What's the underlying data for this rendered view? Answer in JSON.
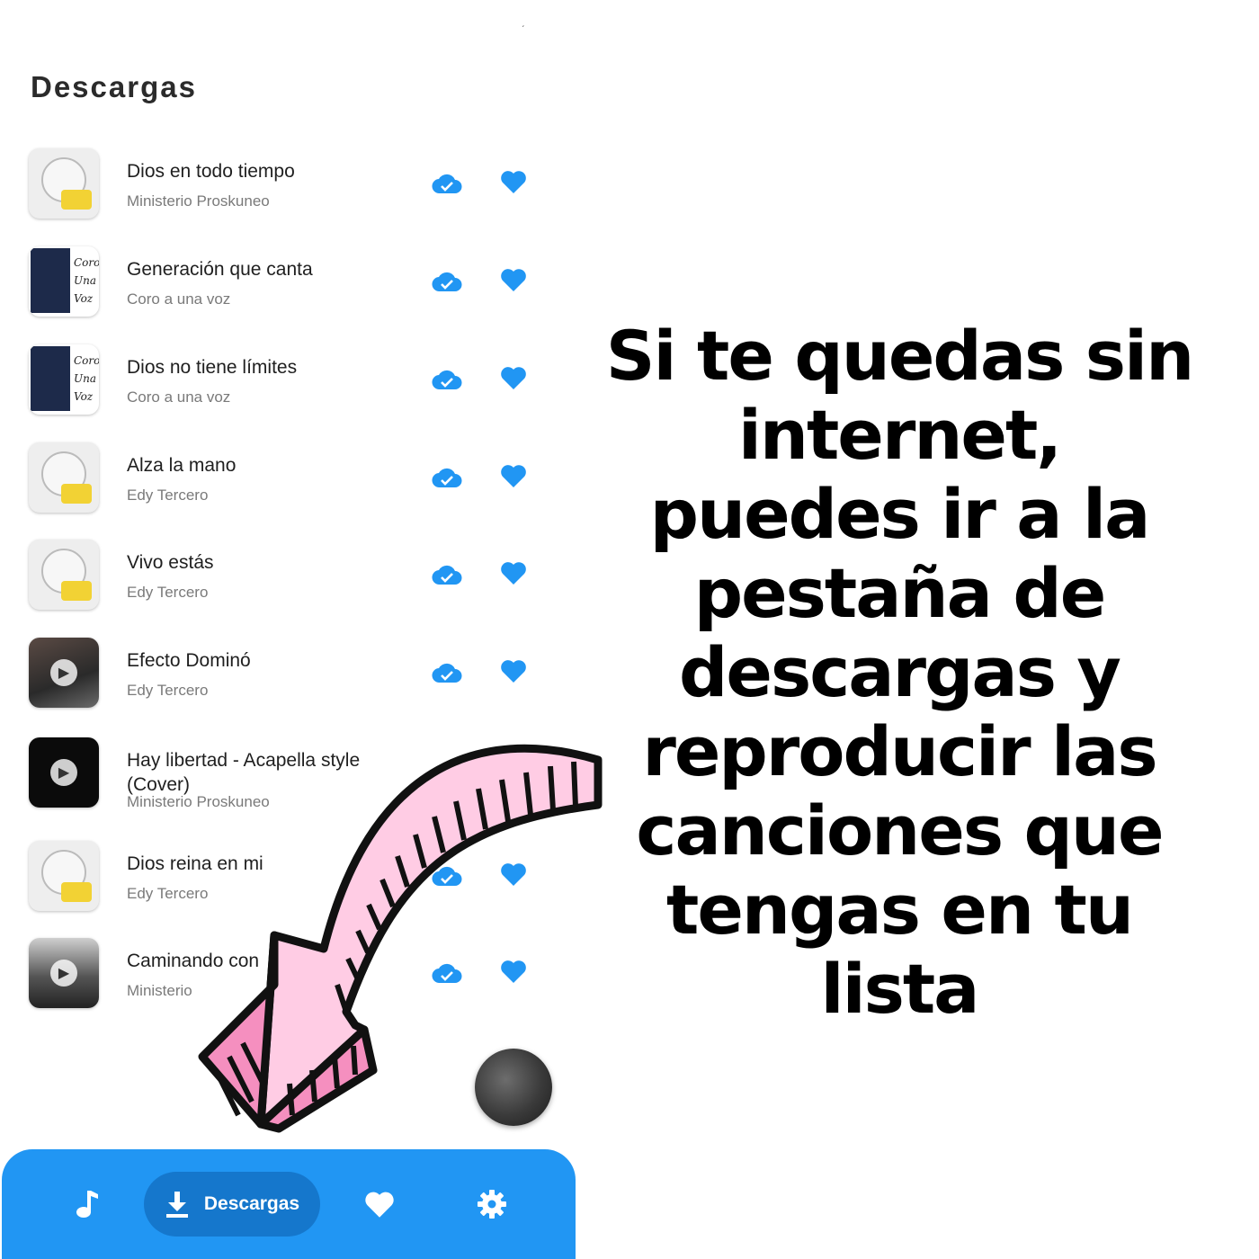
{
  "header": {
    "title": "Descargas",
    "tick": "ˊ"
  },
  "songs": [
    {
      "title": "Dios en todo tiempo",
      "artist": "Ministerio Proskuneo",
      "cover": "logo"
    },
    {
      "title": "Generación que canta",
      "artist": "Coro a una voz",
      "cover": "coro"
    },
    {
      "title": "Dios no tiene límites",
      "artist": "Coro a una voz",
      "cover": "coro"
    },
    {
      "title": "Alza la mano",
      "artist": "Edy Tercero",
      "cover": "logo"
    },
    {
      "title": "Vivo estás",
      "artist": "Edy Tercero",
      "cover": "logo"
    },
    {
      "title": "Efecto Dominó",
      "artist": "Edy Tercero",
      "cover": "photo"
    },
    {
      "title": "Hay libertad - Acapella style (Cover)",
      "artist": "Ministerio Proskuneo",
      "cover": "dark"
    },
    {
      "title": "Dios reina en mi",
      "artist": "Edy Tercero",
      "cover": "logo"
    },
    {
      "title": "Caminando con",
      "artist": "Ministerio",
      "cover": "road"
    }
  ],
  "cover_art_text": {
    "coro": [
      "Coro",
      "Una",
      "Voz"
    ]
  },
  "callout": {
    "text": "Si te quedas sin internet, puedes ir a la pestaña de descargas y reproducir las canciones que tengas en tu lista"
  },
  "bottom_nav": {
    "items": [
      {
        "icon": "music-note-icon"
      },
      {
        "icon": "download-icon",
        "label": "Descargas",
        "active": true
      },
      {
        "icon": "heart-icon"
      },
      {
        "icon": "gear-icon"
      }
    ]
  },
  "colors": {
    "accent": "#2196f3",
    "accent_dark": "#1577cc",
    "icon_blue": "#2196f3",
    "arrow_pink": "#ffcce4",
    "arrow_stripe": "#f58fbf"
  }
}
